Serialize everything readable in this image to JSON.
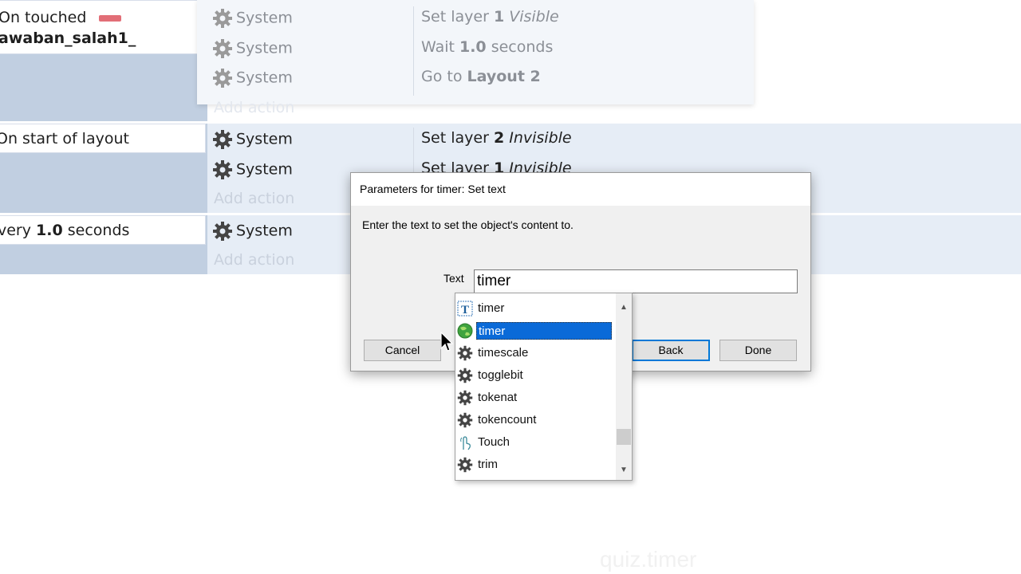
{
  "events": {
    "event1": {
      "condition_line1": "On touched",
      "condition_line2": "awaban_salah1_",
      "actions": [
        {
          "object": "System",
          "pre": "Set layer ",
          "bold": "1",
          "post_italic": " Visible",
          "post": ""
        },
        {
          "object": "System",
          "pre": "Wait ",
          "bold": "1.0",
          "post_italic": "",
          "post": " seconds"
        },
        {
          "object": "System",
          "pre": "Go to ",
          "bold": "Layout 2",
          "post_italic": "",
          "post": ""
        }
      ],
      "add_action": "Add action"
    },
    "event2": {
      "condition": "On start of layout",
      "actions": [
        {
          "object": "System",
          "pre": "Set layer ",
          "bold": "2",
          "post_italic": " Invisible",
          "post": ""
        },
        {
          "object": "System",
          "pre": "Set layer ",
          "bold": "1",
          "post_italic": " Invisible",
          "post": ""
        }
      ],
      "add_action": "Add action"
    },
    "event3": {
      "condition_pre": "very ",
      "condition_bold": "1.0",
      "condition_post": " seconds",
      "actions": [
        {
          "object": "System"
        }
      ],
      "add_action": "Add action"
    }
  },
  "dialog": {
    "title": "Parameters for timer: Set text",
    "description": "Enter the text to set the object's content to.",
    "text_label": "Text",
    "text_value": "timer",
    "cancel": "Cancel",
    "back": "Back",
    "done": "Done"
  },
  "autocomplete": {
    "items": [
      {
        "label": "timer",
        "icon": "text-object-icon",
        "selected": false
      },
      {
        "label": "timer",
        "icon": "globe-icon",
        "selected": true
      },
      {
        "label": "timescale",
        "icon": "gear-icon",
        "selected": false
      },
      {
        "label": "togglebit",
        "icon": "gear-icon",
        "selected": false
      },
      {
        "label": "tokenat",
        "icon": "gear-icon",
        "selected": false
      },
      {
        "label": "tokencount",
        "icon": "gear-icon",
        "selected": false
      },
      {
        "label": "Touch",
        "icon": "touch-hand-icon",
        "selected": false
      },
      {
        "label": "trim",
        "icon": "gear-icon",
        "selected": false
      }
    ]
  },
  "watermark": "quiz.timer",
  "colors": {
    "selection": "#0a6ad8",
    "condition_column": "#c1cfe1",
    "row_band": "#e6edf6",
    "focus_border": "#0078d7"
  }
}
